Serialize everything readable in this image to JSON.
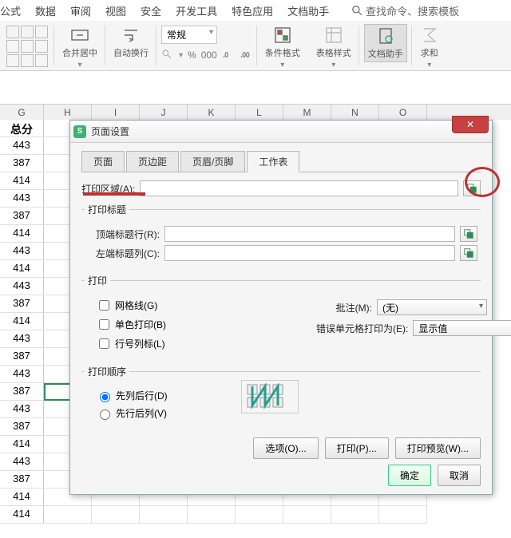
{
  "menu": {
    "items": [
      "公式",
      "数据",
      "审阅",
      "视图",
      "安全",
      "开发工具",
      "特色应用",
      "文档助手"
    ],
    "search": "查找命令、搜索模板"
  },
  "ribbon": {
    "merge": "合并居中",
    "wrap": "自动换行",
    "format_value": "常规",
    "cond": "条件格式",
    "style": "表格样式",
    "doc": "文档助手",
    "sum": "求和"
  },
  "sheet": {
    "cols": [
      "G",
      "H",
      "I",
      "J",
      "K",
      "L",
      "M",
      "N",
      "O"
    ],
    "header": "总分",
    "values": [
      443,
      387,
      414,
      443,
      387,
      414,
      443,
      414,
      443,
      387,
      414,
      443,
      387,
      443,
      387,
      443,
      387,
      414,
      443,
      387,
      414,
      414
    ]
  },
  "dialog": {
    "title": "页面设置",
    "tabs": [
      "页面",
      "页边距",
      "页眉/页脚",
      "工作表"
    ],
    "active_tab": 3,
    "print_area_label": "打印区域(A):",
    "titles_legend": "打印标题",
    "top_row_label": "顶端标题行(R):",
    "left_col_label": "左端标题列(C):",
    "print_legend": "打印",
    "gridlines": "网格线(G)",
    "mono": "单色打印(B)",
    "rowcol": "行号列标(L)",
    "comments_label": "批注(M):",
    "comments_value": "(无)",
    "errors_label": "错误单元格打印为(E):",
    "errors_value": "显示值",
    "order_legend": "打印顺序",
    "order_down": "先列后行(D)",
    "order_over": "先行后列(V)",
    "btn_options": "选项(O)...",
    "btn_print": "打印(P)...",
    "btn_preview": "打印预览(W)...",
    "btn_ok": "确定",
    "btn_cancel": "取消"
  }
}
